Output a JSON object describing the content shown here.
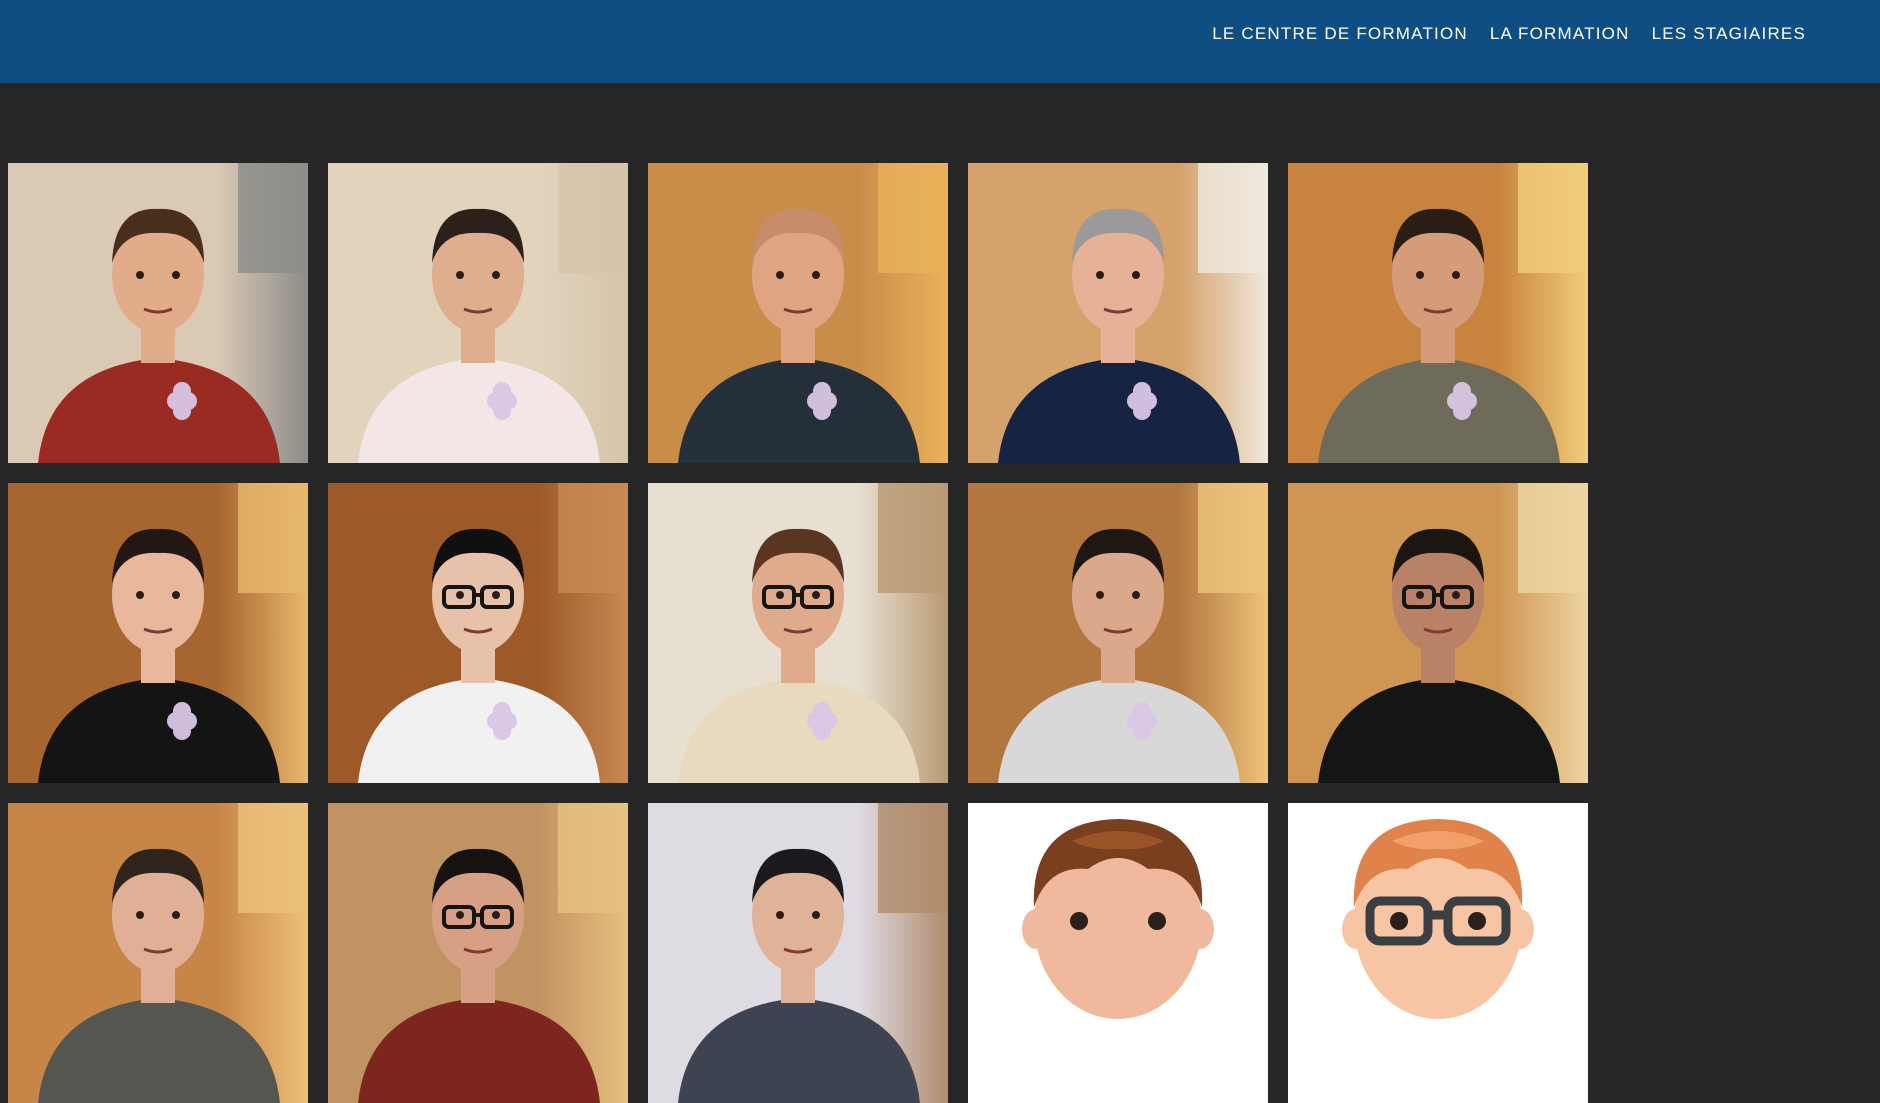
{
  "nav": {
    "items": [
      {
        "label": "LE CENTRE DE FORMATION"
      },
      {
        "label": "LA FORMATION"
      },
      {
        "label": "LES STAGIAIRES"
      }
    ]
  },
  "colors": {
    "header": "#0f4e82",
    "page_background": "#262626",
    "nav_text": "#ffffff"
  },
  "gallery": {
    "tiles": [
      {
        "type": "photo",
        "bg": "#d9c9b5",
        "wall2": "#8c8c88",
        "skin": "#e2ac8a",
        "hair": "#4a2e1c",
        "shirt": "#9b2a22",
        "badge": true,
        "glasses": false
      },
      {
        "type": "photo",
        "bg": "#e2d3bd",
        "wall2": "#d6c4aa",
        "skin": "#dfae8e",
        "hair": "#2b201a",
        "shirt": "#f2e7e6",
        "badge": true,
        "glasses": false
      },
      {
        "type": "photo",
        "bg": "#c98d4a",
        "wall2": "#e9b25a",
        "skin": "#dfa583",
        "hair": "#c78c6c",
        "shirt": "#252f3a",
        "badge": true,
        "glasses": false
      },
      {
        "type": "photo",
        "bg": "#d4a26a",
        "wall2": "#efe8dd",
        "skin": "#e6b197",
        "hair": "#9a9a9a",
        "shirt": "#172342",
        "badge": true,
        "glasses": false
      },
      {
        "type": "photo",
        "bg": "#c8843e",
        "wall2": "#f1cd79",
        "skin": "#d59c79",
        "hair": "#2a1d14",
        "shirt": "#6f6b5a",
        "badge": true,
        "glasses": false
      },
      {
        "type": "photo",
        "bg": "#a7662f",
        "wall2": "#e7b86d",
        "skin": "#e9b79b",
        "hair": "#231713",
        "shirt": "#141414",
        "badge": true,
        "glasses": false
      },
      {
        "type": "photo",
        "bg": "#9d5a28",
        "wall2": "#c88953",
        "skin": "#e8c2a8",
        "hair": "#101010",
        "shirt": "#f1f1f1",
        "badge": true,
        "glasses": true
      },
      {
        "type": "photo",
        "bg": "#e7dfd1",
        "wall2": "#b99a74",
        "skin": "#e0aa8c",
        "hair": "#5a3520",
        "shirt": "#e8d9bf",
        "badge": true,
        "glasses": true
      },
      {
        "type": "photo",
        "bg": "#b2773f",
        "wall2": "#eec37a",
        "skin": "#dca88c",
        "hair": "#1e1712",
        "shirt": "#d8d8d8",
        "badge": true,
        "glasses": false
      },
      {
        "type": "photo",
        "bg": "#cf9653",
        "wall2": "#eed4a0",
        "skin": "#b98267",
        "hair": "#1c1613",
        "shirt": "#141616",
        "badge": false,
        "glasses": true
      },
      {
        "type": "photo",
        "bg": "#c88548",
        "wall2": "#ecc07b",
        "skin": "#dfb095",
        "hair": "#2e241c",
        "shirt": "#55564f",
        "badge": false,
        "glasses": false
      },
      {
        "type": "photo",
        "bg": "#c19362",
        "wall2": "#e6c07e",
        "skin": "#d7a084",
        "hair": "#161210",
        "shirt": "#7d2620",
        "badge": false,
        "glasses": true
      },
      {
        "type": "photo",
        "bg": "#dfdbe2",
        "wall2": "#b08c6c",
        "skin": "#e0b298",
        "hair": "#1c1a1c",
        "shirt": "#3d4350",
        "badge": false,
        "glasses": false
      },
      {
        "type": "avatar",
        "bg": "#ffffff",
        "skin": "#f0b99d",
        "hair": "#7a3f1e",
        "hair_light": "#9a5428",
        "glasses": false
      },
      {
        "type": "avatar",
        "bg": "#ffffff",
        "skin": "#f7c4a4",
        "hair": "#e0834a",
        "hair_light": "#f1a06a",
        "glasses": true
      }
    ]
  }
}
